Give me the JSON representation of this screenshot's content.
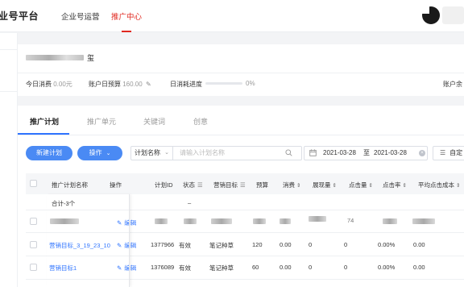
{
  "header": {
    "brand": "业号平台",
    "nav": [
      "企业号运营",
      "推广中心"
    ],
    "active_nav_index": 1
  },
  "account": {
    "name_suffix": "玺",
    "stats": {
      "today_spend_label": "今日消费",
      "today_spend_value": "0.00元",
      "daily_budget_label": "账户日预算",
      "daily_budget_value": "160.00",
      "daily_progress_label": "日消耗进度",
      "daily_progress_value": "0%",
      "daily_progress_fraction": 0,
      "balance_label": "账户余"
    }
  },
  "tabs": [
    "推广计划",
    "推广单元",
    "关键词",
    "创意"
  ],
  "toolbar": {
    "new_plan": "新建计划",
    "operate": "操作",
    "field_select": "计划名称",
    "search_placeholder": "请输入计划名称",
    "date_start": "2021-03-28",
    "date_sep": "至",
    "date_end": "2021-03-28",
    "custom": "自定"
  },
  "table": {
    "headers": [
      "推广计划名称",
      "操作",
      "计划ID",
      "状态",
      "营销目标",
      "预算",
      "消费",
      "展现量",
      "点击量",
      "点击率",
      "平均点击成本"
    ],
    "summary": {
      "name": "合计-3个",
      "plan_id": "–"
    },
    "rows": [
      {
        "name": "",
        "action": "编辑",
        "plan_id": "",
        "status": "",
        "goal": "",
        "budget": "",
        "spend": "",
        "impressions": "",
        "clicks": "74",
        "ctr": "",
        "avg_cpc": "",
        "masked": true
      },
      {
        "name": "营销目标_3_19_23_10",
        "action": "编辑",
        "plan_id": "1377966",
        "status": "有效",
        "goal": "笔记种草",
        "budget": "120",
        "spend": "0.00",
        "impressions": "0",
        "clicks": "0",
        "ctr": "0.00%",
        "avg_cpc": "0.00"
      },
      {
        "name": "营销目标1",
        "action": "编辑",
        "plan_id": "1376089",
        "status": "有效",
        "goal": "笔记种草",
        "budget": "60",
        "spend": "0.00",
        "impressions": "0",
        "clicks": "0",
        "ctr": "0.00%",
        "avg_cpc": "0.00"
      }
    ]
  },
  "colors": {
    "accent": "#e0281f",
    "primary": "#4a8af4",
    "link": "#2f74ff"
  }
}
